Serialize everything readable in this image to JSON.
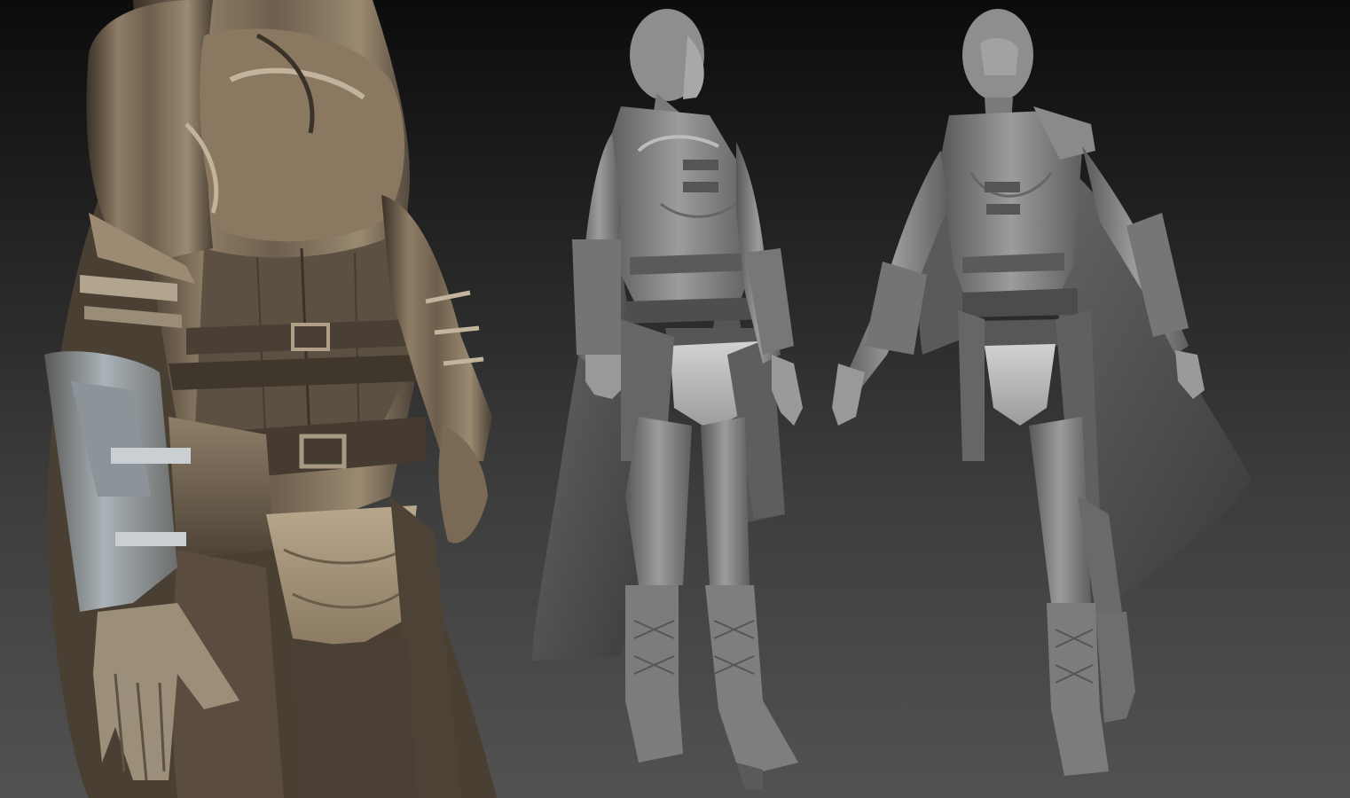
{
  "scene": {
    "description_free": true,
    "views": [
      {
        "id": "closeup-torso",
        "material": "bronze-matcap",
        "base_color": "#7a6a55"
      },
      {
        "id": "full-body-three-quarter",
        "material": "gray-clay",
        "base_color": "#8c8c8c"
      },
      {
        "id": "full-body-front",
        "material": "gray-clay",
        "base_color": "#8a8a8a"
      }
    ],
    "colors": {
      "background_top": "#0c0c0c",
      "background_bottom": "#525252",
      "bronze_light": "#a8967c",
      "bronze_dark": "#3a3128",
      "clay_light": "#b0b0b0",
      "clay_dark": "#4a4a4a"
    }
  }
}
